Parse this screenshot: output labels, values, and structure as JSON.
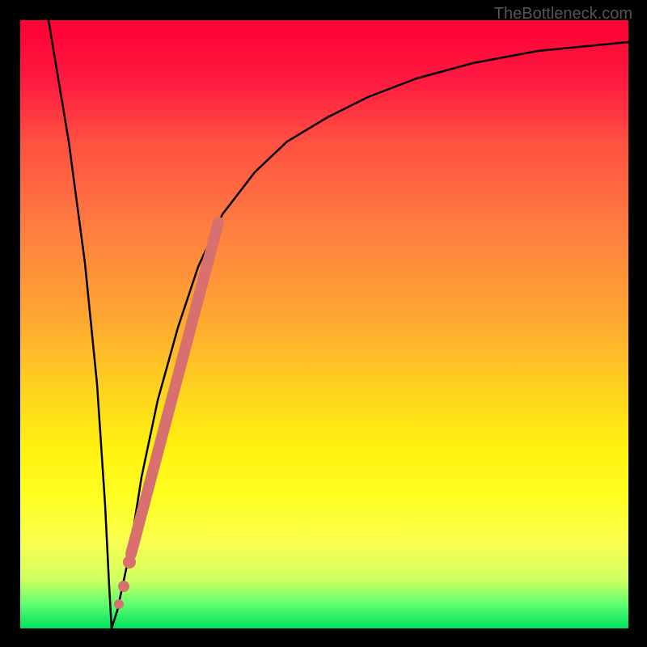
{
  "watermark": "TheBottleneck.com",
  "chart_data": {
    "type": "line",
    "title": "",
    "xlabel": "",
    "ylabel": "",
    "xlim": [
      0,
      100
    ],
    "ylim": [
      0,
      100
    ],
    "background_gradient": {
      "top_color": "#ff0033",
      "bottom_color": "#00e060",
      "description": "red-yellow-green vertical gradient (bottleneck severity)"
    },
    "series": [
      {
        "name": "bottleneck-curve",
        "color": "#000000",
        "x": [
          0,
          3,
          6,
          9,
          11,
          12,
          13,
          14,
          16,
          18,
          20,
          23,
          26,
          30,
          35,
          40,
          46,
          53,
          62,
          73,
          85,
          100
        ],
        "y": [
          100,
          80,
          60,
          40,
          20,
          7,
          0,
          3,
          12,
          25,
          38,
          50,
          60,
          68,
          75,
          80,
          84,
          87.5,
          90.5,
          93,
          95,
          96.5
        ]
      },
      {
        "name": "highlight-segment",
        "color": "#d87070",
        "style": "thick",
        "x": [
          16,
          18,
          20,
          23,
          26,
          30
        ],
        "y": [
          12,
          25,
          38,
          50,
          60,
          68
        ]
      },
      {
        "name": "highlight-dots",
        "color": "#d87070",
        "style": "points",
        "x": [
          14.5,
          15.2,
          16
        ],
        "y": [
          4,
          8,
          12
        ]
      }
    ]
  }
}
